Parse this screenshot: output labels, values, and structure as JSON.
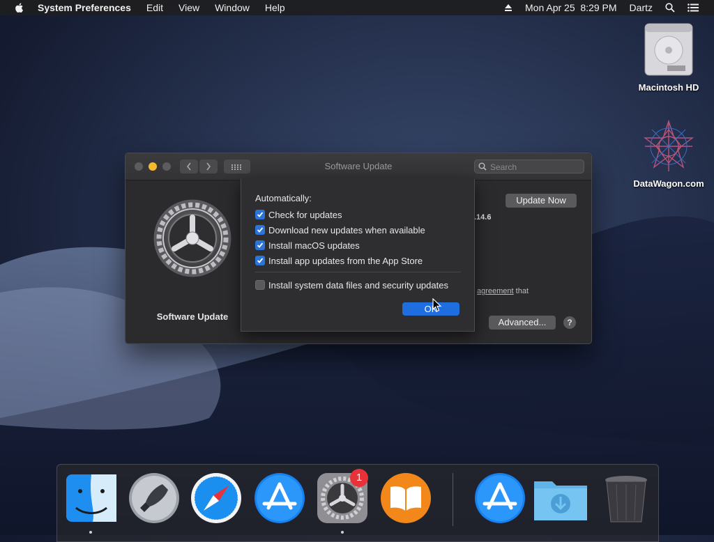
{
  "menubar": {
    "app_name": "System Preferences",
    "menus": [
      "Edit",
      "View",
      "Window",
      "Help"
    ],
    "clock": "Mon Apr 25  8:29 PM",
    "user": "Dartz"
  },
  "desktop": {
    "icons": [
      {
        "label": "Macintosh HD",
        "icon": "hard-drive-icon"
      },
      {
        "label": "DataWagon.com",
        "icon": "datawagon-logo-icon"
      }
    ]
  },
  "window": {
    "title": "Software Update",
    "search_placeholder": "Search",
    "pane_label": "Software Update",
    "update_now_label": "Update Now",
    "version_fragment": ".14.6",
    "agreement_link": "agreement",
    "agreement_rest": " that",
    "advanced_label": "Advanced...",
    "help_label": "?"
  },
  "sheet": {
    "heading": "Automatically:",
    "options": [
      {
        "label": "Check for updates",
        "checked": true
      },
      {
        "label": "Download new updates when available",
        "checked": true
      },
      {
        "label": "Install macOS updates",
        "checked": true
      },
      {
        "label": "Install app updates from the App Store",
        "checked": true
      },
      {
        "label": "Install system data files and security updates",
        "checked": false
      }
    ],
    "ok_label": "OK"
  },
  "dock": {
    "apps": [
      "Finder",
      "Launchpad",
      "Safari",
      "App Store",
      "System Preferences",
      "iBooks",
      "App Store Downloads",
      "Downloads",
      "Trash"
    ],
    "badge": "1"
  },
  "colors": {
    "accent": "#1e6ee0",
    "badge": "#e8323a",
    "window_bg": "#2b2b2d"
  }
}
